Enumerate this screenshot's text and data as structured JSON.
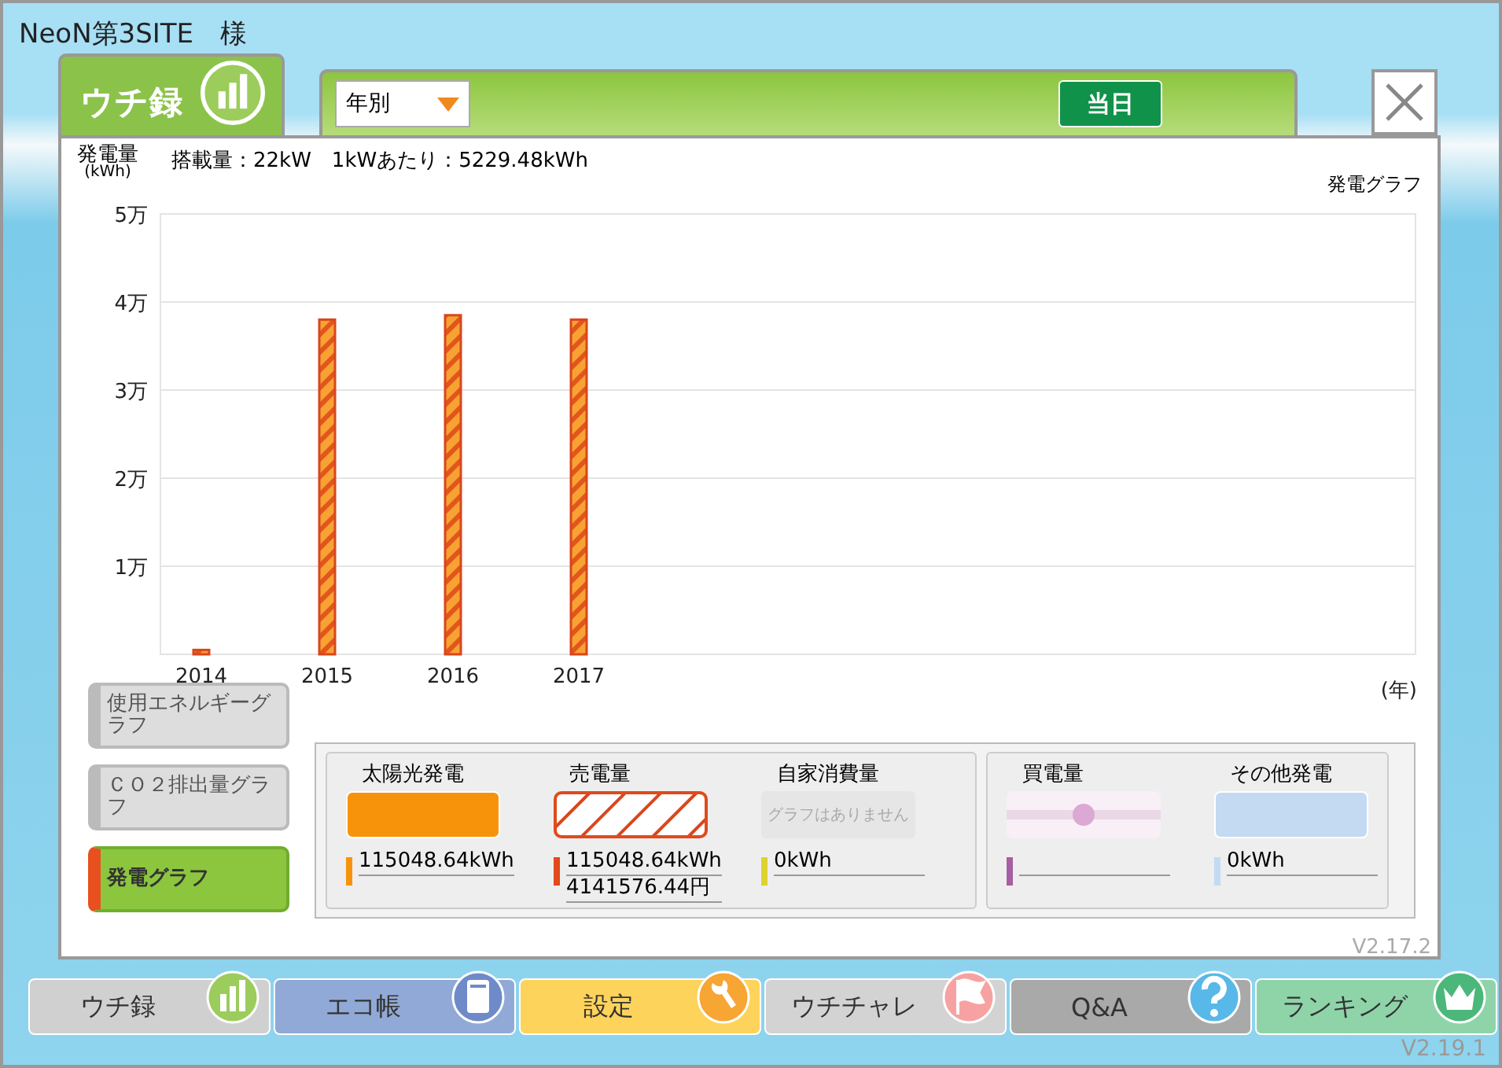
{
  "user": {
    "name": "NeoN第3SITE　様"
  },
  "tab": {
    "label": "ウチ録"
  },
  "toolbar": {
    "period": "年別",
    "today_button": "当日"
  },
  "header": {
    "axis_title": "発電量",
    "axis_unit": "(kWh)",
    "summary": "搭載量：22kW　1kWあたり：5229.48kWh",
    "graph_title": "発電グラフ"
  },
  "chart_data": {
    "type": "bar",
    "categories": [
      "2014",
      "2015",
      "2016",
      "2017"
    ],
    "values": [
      0.05,
      3.8,
      3.85,
      3.8
    ],
    "yticks": [
      {
        "value": 1,
        "label": "1万"
      },
      {
        "value": 2,
        "label": "2万"
      },
      {
        "value": 3,
        "label": "3万"
      },
      {
        "value": 4,
        "label": "4万"
      },
      {
        "value": 5,
        "label": "5万"
      }
    ],
    "ylim": [
      0,
      5
    ],
    "grid": true,
    "annotations": [
      {
        "text": "(年)"
      }
    ]
  },
  "graph_buttons": [
    {
      "label": "使用エネルギーグラフ",
      "selected": false
    },
    {
      "label": "ＣＯ２排出量グラフ",
      "selected": false
    },
    {
      "label": "発電グラフ",
      "selected": true
    }
  ],
  "legend_groups": [
    {
      "items": [
        {
          "kind": "solid",
          "title": "太陽光発電",
          "color": "#f7930a",
          "values": [
            "115048.64kWh"
          ]
        },
        {
          "kind": "hatch",
          "title": "売電量",
          "color": "#e04a1c",
          "values": [
            "115048.64kWh",
            "4141576.44円"
          ]
        },
        {
          "kind": "none",
          "title": "自家消費量",
          "note": "グラフはありません",
          "color": "#dcd330",
          "values": [
            "0kWh"
          ]
        }
      ]
    },
    {
      "items": [
        {
          "kind": "slider",
          "title": "買電量",
          "level": 0.5,
          "color": "#a65fa0"
        },
        {
          "kind": "solid",
          "title": "その他発電",
          "color": "#c3daf2",
          "values": [
            "0kWh"
          ]
        }
      ]
    }
  ],
  "nav": [
    {
      "label": "ウチ録",
      "color": "#d0d0d0"
    },
    {
      "label": "エコ帳",
      "color": "#91a9d6"
    },
    {
      "label": "設定",
      "color": "#fdd35c"
    },
    {
      "label": "ウチチャレ",
      "color": "#d3d3d3"
    },
    {
      "label": "Q&A",
      "color": "#a9a9a9"
    },
    {
      "label": "ランキング",
      "color": "#8ed4a8"
    }
  ],
  "versions": {
    "panel": "V2.17.2",
    "app": "V2.19.1"
  }
}
